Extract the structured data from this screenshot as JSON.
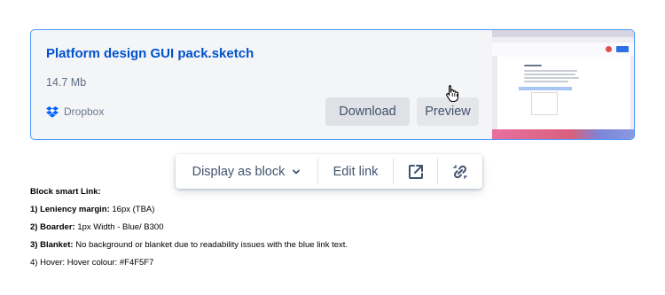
{
  "card": {
    "title": "Platform design GUI pack.sketch",
    "size": "14.7 Mb",
    "provider": "Dropbox",
    "provider_icon": "dropbox-icon",
    "download_label": "Download",
    "preview_label": "Preview",
    "border_color": "#4C9AFF",
    "background_color": "#F4F5F7",
    "title_color": "#0052CC"
  },
  "toolbar": {
    "display_label": "Display as block",
    "edit_label": "Edit link",
    "open_icon": "open-in-new-window-icon",
    "unlink_icon": "unlink-icon"
  },
  "notes": {
    "heading": "Block smart Link:",
    "items": [
      {
        "label": "1) Leniency margin:",
        "text": " 16px (TBA)"
      },
      {
        "label": "2) Boarder:",
        "text": " 1px Width - Blue/ B300"
      },
      {
        "label": "3) Blanket:",
        "text": " No background or blanket due to readability issues with the blue link text."
      },
      {
        "label": "4) Hover:",
        "text": " Hover colour: #F4F5F7"
      }
    ]
  }
}
